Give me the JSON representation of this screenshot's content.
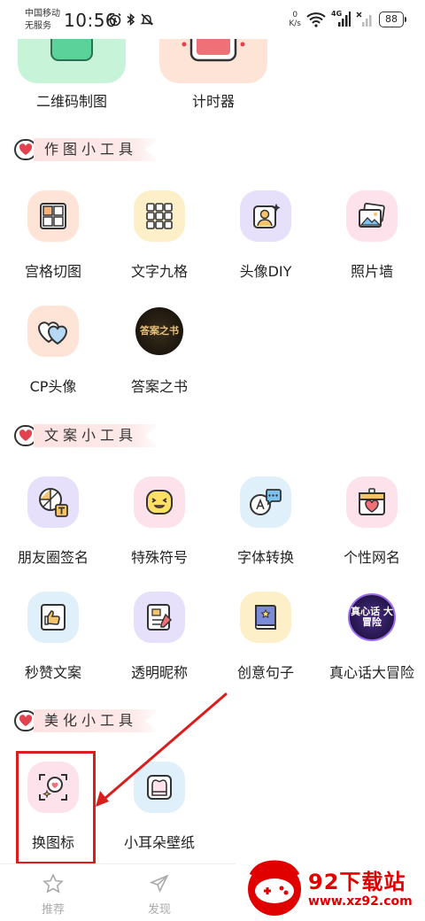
{
  "status_bar": {
    "carrier_line1": "中国移动",
    "carrier_line2": "无服务",
    "time": "10:56",
    "net_speed_value": "0",
    "net_speed_unit": "K/s",
    "network_type": "4G",
    "battery": "88"
  },
  "top_tools": [
    {
      "label": "二维码制图",
      "icon": "qr-code-icon",
      "color": "#c7f3d8"
    },
    {
      "label": "计时器",
      "icon": "timer-icon",
      "color": "#fde4d6"
    }
  ],
  "sections": [
    {
      "title": "作图小工具",
      "tools": [
        {
          "label": "宫格切图",
          "icon": "grid-cut-icon",
          "color": "#fde4d6"
        },
        {
          "label": "文字九格",
          "icon": "text-nine-grid-icon",
          "color": "#fdf0c8"
        },
        {
          "label": "头像DIY",
          "icon": "avatar-diy-icon",
          "color": "#e6e0fb"
        },
        {
          "label": "照片墙",
          "icon": "photo-wall-icon",
          "color": "#fde2ec"
        },
        {
          "label": "CP头像",
          "icon": "cp-avatar-icon",
          "color": "#fde4d6"
        },
        {
          "label": "答案之书",
          "icon": "answer-book-image",
          "color": "#1e1a14",
          "image_text": "答案之书"
        }
      ]
    },
    {
      "title": "文案小工具",
      "tools": [
        {
          "label": "朋友圈签名",
          "icon": "moments-signature-icon",
          "color": "#e6e0fb"
        },
        {
          "label": "特殊符号",
          "icon": "emoji-symbol-icon",
          "color": "#fde2ec"
        },
        {
          "label": "字体转换",
          "icon": "font-convert-icon",
          "color": "#dff0fb"
        },
        {
          "label": "个性网名",
          "icon": "nickname-icon",
          "color": "#fde2ec"
        },
        {
          "label": "秒赞文案",
          "icon": "thumbs-up-icon",
          "color": "#dff0fb"
        },
        {
          "label": "透明昵称",
          "icon": "transparent-nickname-icon",
          "color": "#e6e0fb"
        },
        {
          "label": "创意句子",
          "icon": "creative-sentence-icon",
          "color": "#fdf0c8"
        },
        {
          "label": "真心话大冒险",
          "icon": "truth-or-dare-image",
          "color": "#1b1240",
          "image_text": "真心话 大冒险"
        }
      ]
    },
    {
      "title": "美化小工具",
      "tools": [
        {
          "label": "换图标",
          "icon": "change-icon-icon",
          "color": "#fde2ec"
        },
        {
          "label": "小耳朵壁纸",
          "icon": "ear-wallpaper-icon",
          "color": "#dff0fb"
        }
      ]
    }
  ],
  "bottom_nav": [
    {
      "label": "推荐",
      "icon": "star-icon"
    },
    {
      "label": "发现",
      "icon": "paper-plane-icon"
    }
  ],
  "watermark": {
    "title": "92下载站",
    "url": "www.xz92.com"
  },
  "colors": {
    "highlight": "#d91e1e",
    "section_heart": "#e0434f"
  }
}
